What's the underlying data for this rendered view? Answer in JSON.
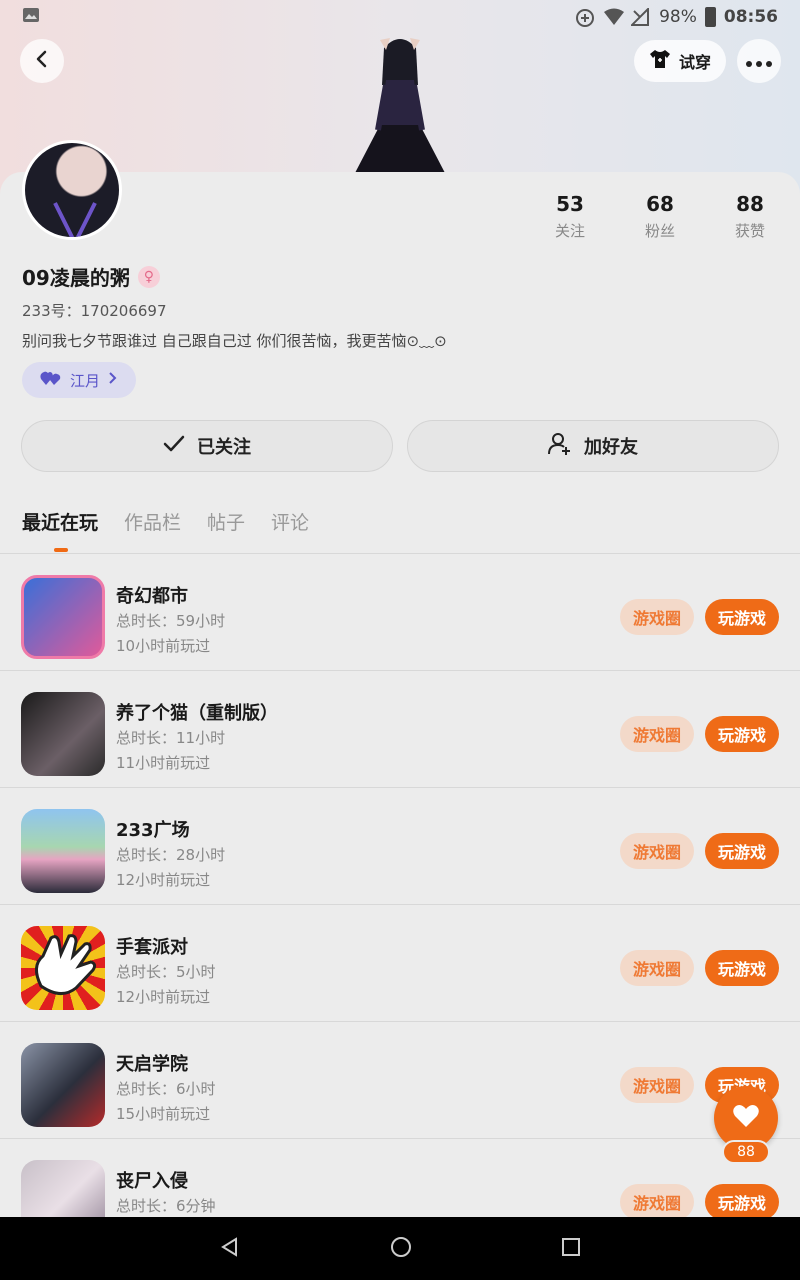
{
  "status_bar": {
    "battery": "98%",
    "time": "08:56"
  },
  "header": {
    "tryon_label": "试穿"
  },
  "profile": {
    "username": "09凌晨的粥",
    "gender_symbol": "♀",
    "uid": "233号：170206697",
    "bio": "别问我七夕节跟谁过 自己跟自己过 你们很苦恼，我更苦恼⊙﹏⊙",
    "tag": "江月",
    "stats": [
      {
        "num": "53",
        "label": "关注"
      },
      {
        "num": "68",
        "label": "粉丝"
      },
      {
        "num": "88",
        "label": "获赞"
      }
    ]
  },
  "actions": {
    "followed": "已关注",
    "add_friend": "加好友"
  },
  "tabs": [
    "最近在玩",
    "作品栏",
    "帖子",
    "评论"
  ],
  "games": [
    {
      "name": "奇幻都市",
      "duration": "总时长：59小时",
      "last": "10小时前玩过",
      "circle": "游戏圈",
      "play": "玩游戏"
    },
    {
      "name": "养了个猫（重制版）",
      "duration": "总时长：11小时",
      "last": "11小时前玩过",
      "circle": "游戏圈",
      "play": "玩游戏"
    },
    {
      "name": "233广场",
      "duration": "总时长：28小时",
      "last": "12小时前玩过",
      "circle": "游戏圈",
      "play": "玩游戏"
    },
    {
      "name": "手套派对",
      "duration": "总时长：5小时",
      "last": "12小时前玩过",
      "circle": "游戏圈",
      "play": "玩游戏"
    },
    {
      "name": "天启学院",
      "duration": "总时长：6小时",
      "last": "15小时前玩过",
      "circle": "游戏圈",
      "play": "玩游戏"
    },
    {
      "name": "丧尸入侵",
      "duration": "总时长：6分钟",
      "last": "",
      "circle": "游戏圈",
      "play": "玩游戏"
    }
  ],
  "like_fab": {
    "count": "88"
  },
  "colors": {
    "accent": "#ef6b17",
    "accent_light": "#f3d9c9",
    "tag_bg": "#dcdcf0"
  }
}
